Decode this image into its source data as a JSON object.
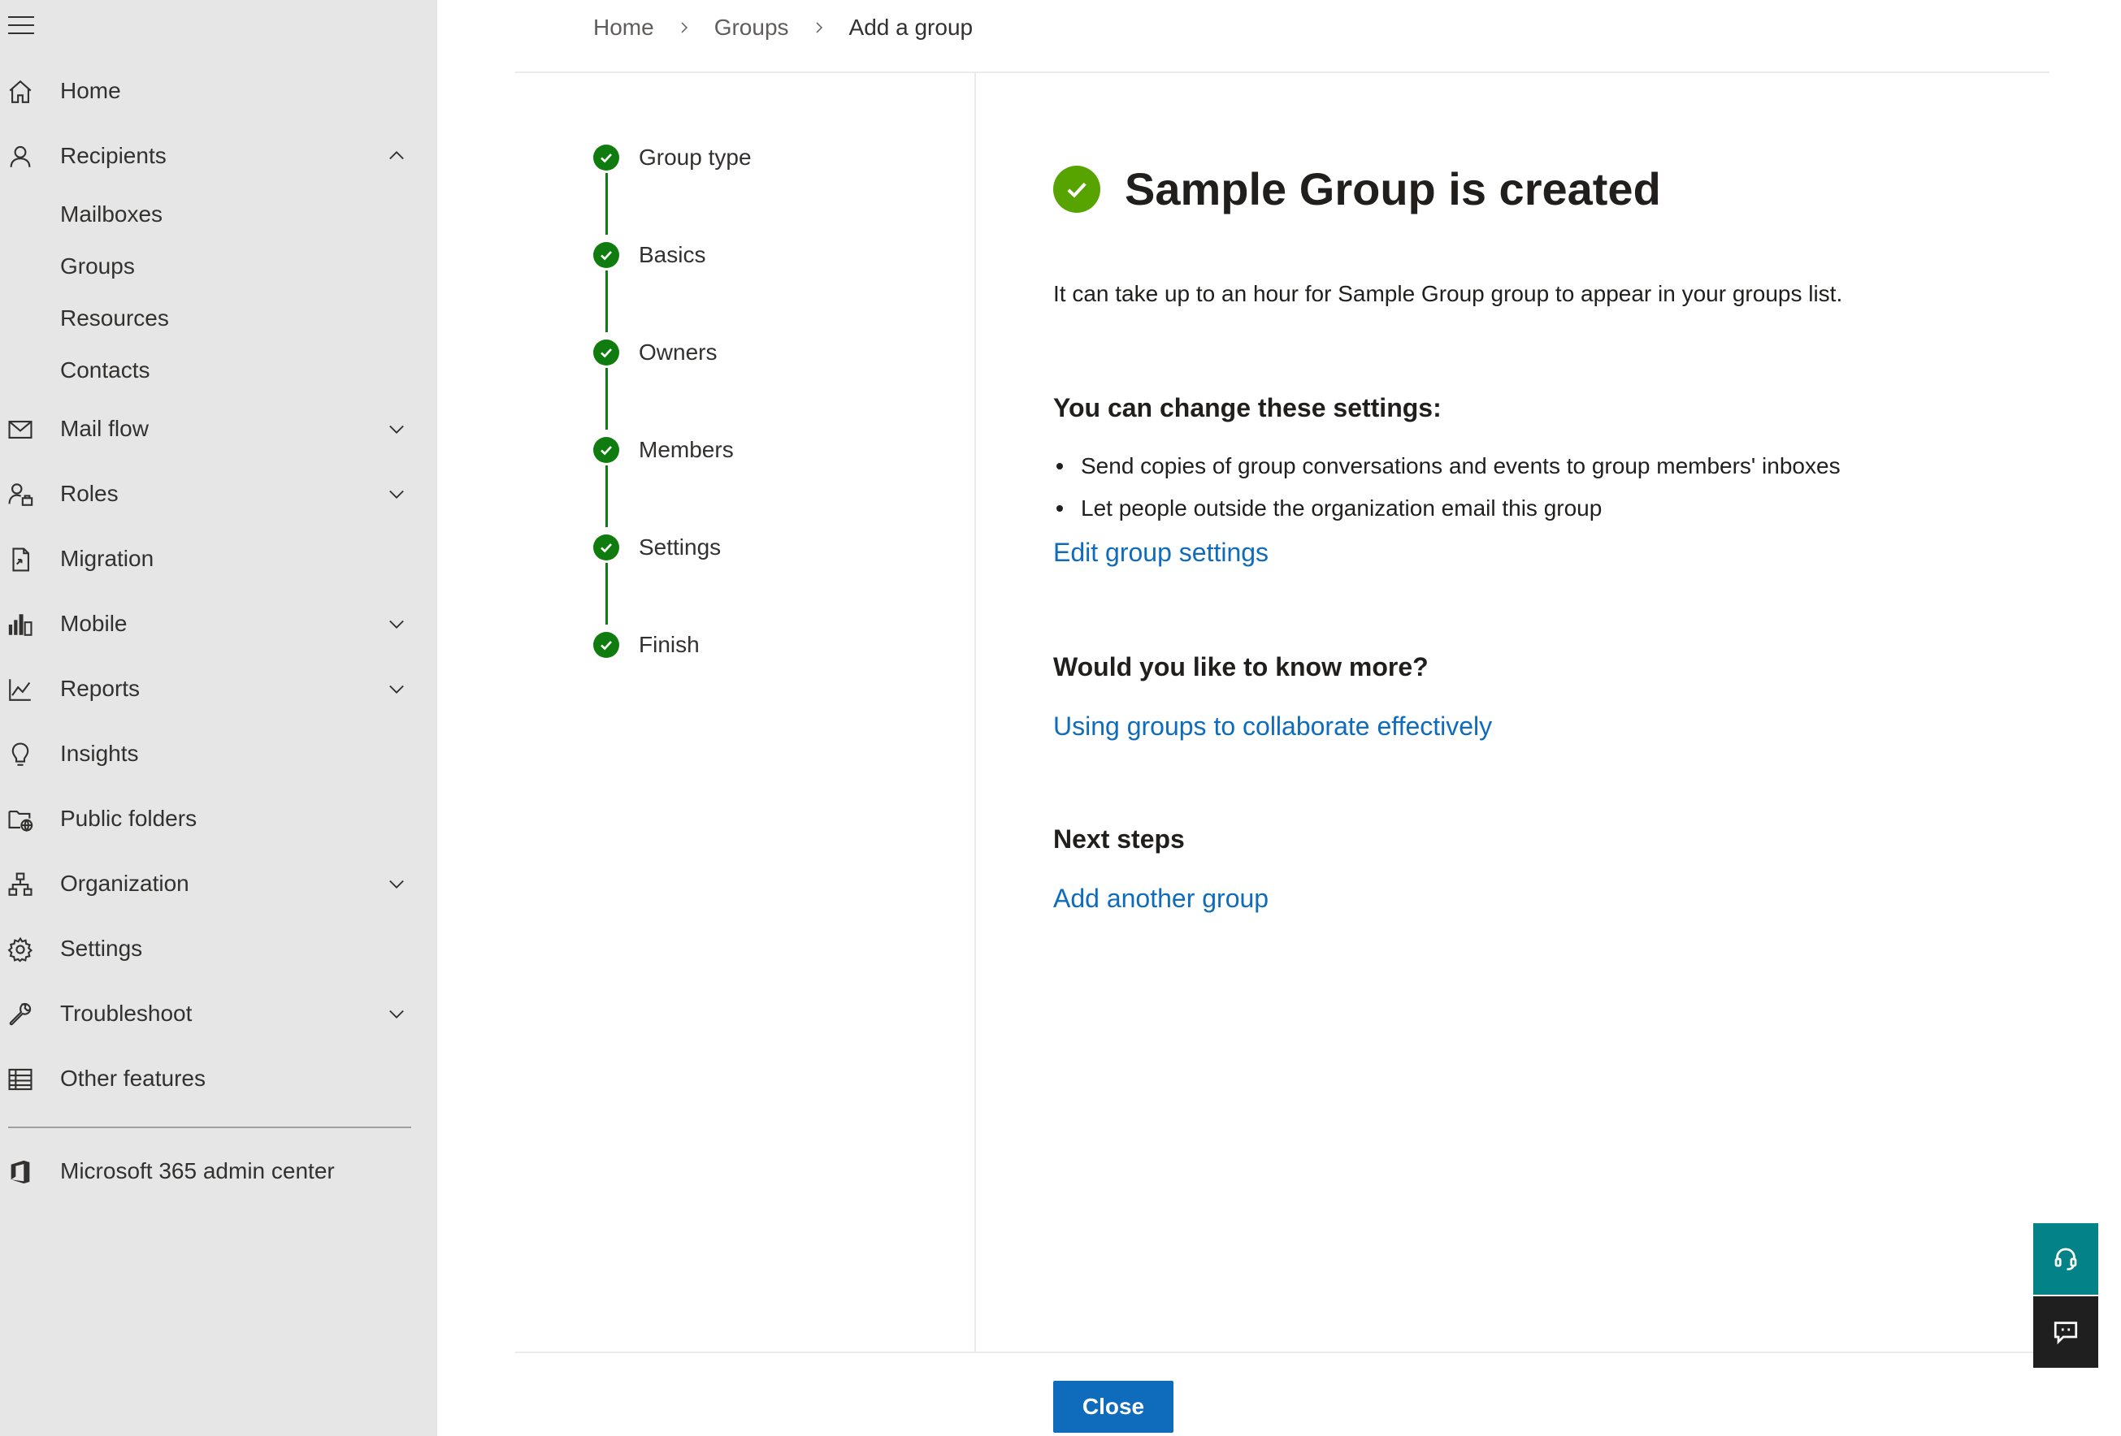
{
  "breadcrumb": {
    "items": [
      "Home",
      "Groups"
    ],
    "current": "Add a group"
  },
  "sidebar": {
    "items": [
      {
        "label": "Home",
        "icon": "home-icon"
      },
      {
        "label": "Recipients",
        "icon": "person-icon",
        "expanded": true
      },
      {
        "label": "Mailboxes"
      },
      {
        "label": "Groups"
      },
      {
        "label": "Resources"
      },
      {
        "label": "Contacts"
      },
      {
        "label": "Mail flow",
        "icon": "mail-icon"
      },
      {
        "label": "Roles",
        "icon": "roles-icon"
      },
      {
        "label": "Migration",
        "icon": "migration-icon"
      },
      {
        "label": "Mobile",
        "icon": "mobile-icon"
      },
      {
        "label": "Reports",
        "icon": "chart-icon"
      },
      {
        "label": "Insights",
        "icon": "lightbulb-icon"
      },
      {
        "label": "Public folders",
        "icon": "folder-globe-icon"
      },
      {
        "label": "Organization",
        "icon": "org-chart-icon"
      },
      {
        "label": "Settings",
        "icon": "gear-icon"
      },
      {
        "label": "Troubleshoot",
        "icon": "wrench-icon"
      },
      {
        "label": "Other features",
        "icon": "table-icon"
      }
    ],
    "footer_link": {
      "label": "Microsoft 365 admin center",
      "icon": "office-icon"
    }
  },
  "steps": [
    {
      "label": "Group type",
      "status": "complete"
    },
    {
      "label": "Basics",
      "status": "complete"
    },
    {
      "label": "Owners",
      "status": "complete"
    },
    {
      "label": "Members",
      "status": "complete"
    },
    {
      "label": "Settings",
      "status": "complete"
    },
    {
      "label": "Finish",
      "status": "complete"
    }
  ],
  "main": {
    "title": "Sample Group is created",
    "description": "It can take up to an hour for Sample Group group to appear in your groups list.",
    "settings_heading": "You can change these settings:",
    "settings_bullets": [
      "Send copies of group conversations and events to group members' inboxes",
      "Let people outside the organization email this group"
    ],
    "edit_link": "Edit group settings",
    "know_more_heading": "Would you like to know more?",
    "know_more_link": "Using groups to collaborate effectively",
    "next_steps_heading": "Next steps",
    "next_steps_link": "Add another group"
  },
  "footer": {
    "close_label": "Close"
  },
  "colors": {
    "sidebar_bg": "#e6e6e6",
    "step_complete": "#107c10",
    "success": "#57a300",
    "link": "#0f6cbd",
    "primary_button": "#0f6cbd",
    "help_button": "#038387",
    "feedback_button": "#1f1f1f"
  },
  "floating_buttons": [
    {
      "icon": "headset-icon"
    },
    {
      "icon": "feedback-icon"
    }
  ]
}
